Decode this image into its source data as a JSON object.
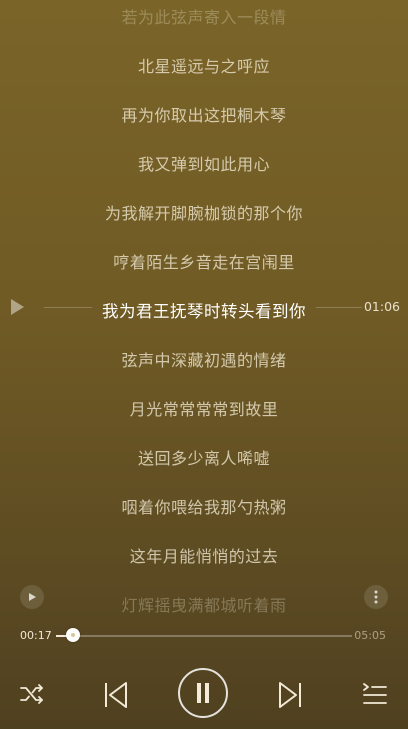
{
  "lyrics": {
    "lines": [
      "若为此弦声寄入一段情",
      "北星遥远与之呼应",
      "再为你取出这把桐木琴",
      "我又弹到如此用心",
      "为我解开脚腕枷锁的那个你",
      "哼着陌生乡音走在宫闱里",
      "我为君王抚琴时转头看到你",
      "弦声中深藏初遇的情绪",
      "月光常常常常到故里",
      "送回多少离人唏嘘",
      "咽着你喂给我那勺热粥",
      "这年月能悄悄的过去",
      "灯辉摇曳满都城听着雨"
    ],
    "current_index": 6,
    "seek_time": "01:06"
  },
  "player": {
    "elapsed": "00:17",
    "total": "05:05",
    "progress": 0.056
  },
  "icons": {
    "shuffle": "shuffle-icon",
    "previous": "previous-icon",
    "pause": "pause-icon",
    "next": "next-icon",
    "playlist": "playlist-icon",
    "seek_play": "play-icon",
    "more": "more-icon"
  },
  "colors": {
    "background_top": "#7a6428",
    "background_bottom": "#4f4020",
    "current_lyric": "#ffffff",
    "lyric": "#f0e8d2"
  }
}
